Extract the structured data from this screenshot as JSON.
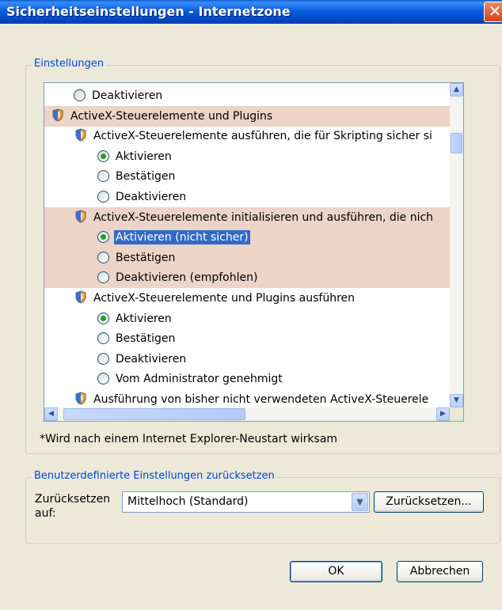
{
  "window": {
    "title": "Sicherheitseinstellungen - Internetzone",
    "close_label": "✕"
  },
  "settings": {
    "group_label": "Einstellungen",
    "rows": [
      {
        "type": "radio",
        "level": 1,
        "label": "Deaktivieren",
        "checked": false
      },
      {
        "type": "category",
        "level": 0,
        "label": "ActiveX-Steuerelemente und Plugins",
        "highlight": true
      },
      {
        "type": "setting",
        "level": 1,
        "label": "ActiveX-Steuerelemente ausführen, die für Skripting sicher si"
      },
      {
        "type": "radio",
        "level": 2,
        "label": "Aktivieren",
        "checked": true
      },
      {
        "type": "radio",
        "level": 2,
        "label": "Bestätigen",
        "checked": false
      },
      {
        "type": "radio",
        "level": 2,
        "label": "Deaktivieren",
        "checked": false
      },
      {
        "type": "setting",
        "level": 1,
        "label": "ActiveX-Steuerelemente initialisieren und ausführen, die nich",
        "highlight": true
      },
      {
        "type": "radio",
        "level": 2,
        "label": "Aktivieren (nicht sicher)",
        "checked": true,
        "highlight": true,
        "selected": true
      },
      {
        "type": "radio",
        "level": 2,
        "label": "Bestätigen",
        "checked": false,
        "highlight": true
      },
      {
        "type": "radio",
        "level": 2,
        "label": "Deaktivieren (empfohlen)",
        "checked": false,
        "highlight": true
      },
      {
        "type": "setting",
        "level": 1,
        "label": "ActiveX-Steuerelemente und Plugins ausführen"
      },
      {
        "type": "radio",
        "level": 2,
        "label": "Aktivieren",
        "checked": true
      },
      {
        "type": "radio",
        "level": 2,
        "label": "Bestätigen",
        "checked": false
      },
      {
        "type": "radio",
        "level": 2,
        "label": "Deaktivieren",
        "checked": false
      },
      {
        "type": "radio",
        "level": 2,
        "label": "Vom Administrator genehmigt",
        "checked": false
      },
      {
        "type": "setting",
        "level": 1,
        "label": "Ausführung von bisher nicht verwendeten ActiveX-Steuerele"
      }
    ],
    "note": "*Wird nach einem Internet Explorer-Neustart wirksam"
  },
  "reset": {
    "group_label": "Benutzerdefinierte Einstellungen zurücksetzen",
    "label_line1": "Zurücksetzen",
    "label_line2": "auf:",
    "combo_value": "Mittelhoch (Standard)",
    "reset_button": "Zurücksetzen..."
  },
  "buttons": {
    "ok": "OK",
    "cancel": "Abbrechen"
  },
  "colors": {
    "accent": "#0046d5",
    "selection": "#316ac5",
    "highlight_row": "#ecd4c6",
    "radio_dot": "#21a121"
  }
}
